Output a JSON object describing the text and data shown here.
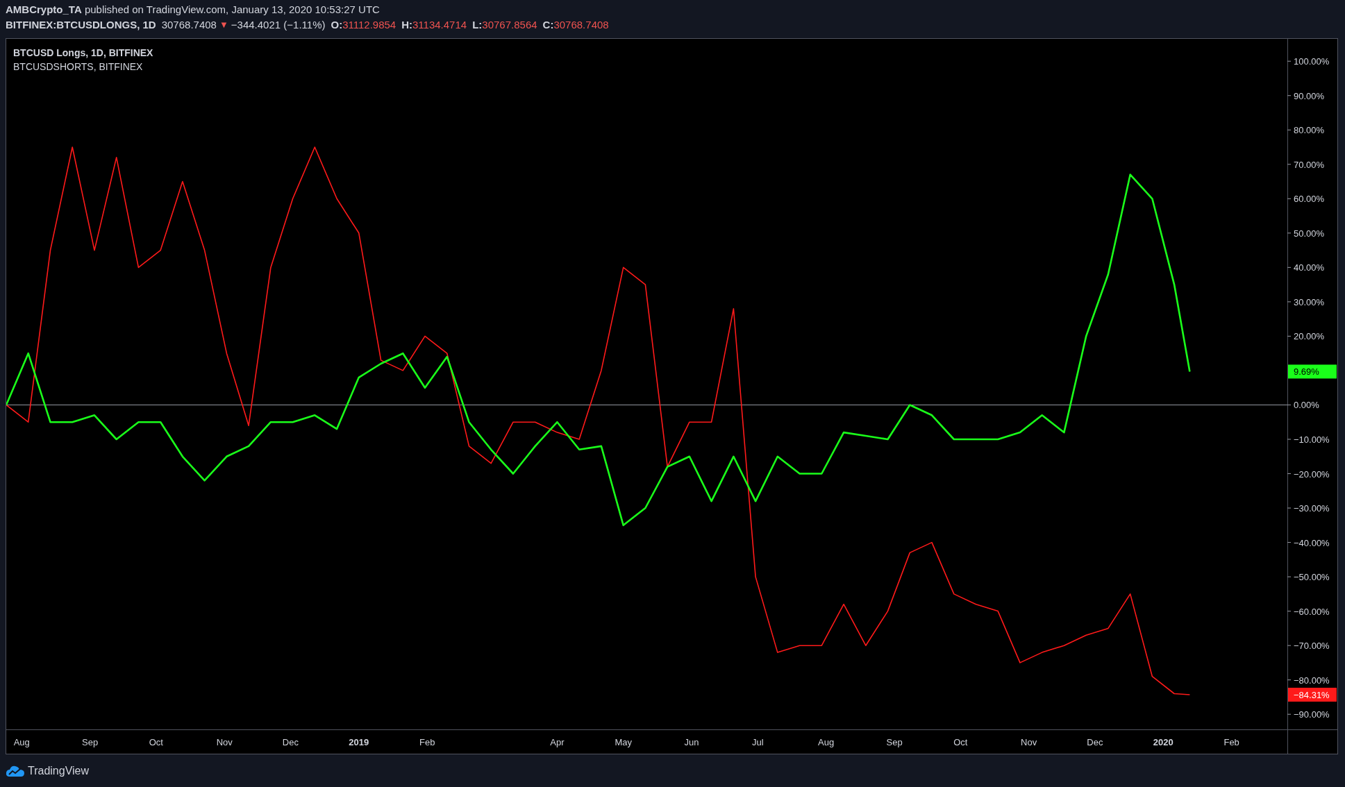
{
  "header": {
    "publish_info": "**AMBCrypto_TA** published on TradingView.com, January 13, 2020 10:53:27 UTC",
    "symbol": "BITFINEX:BTCUSDLONGS, 1D",
    "last": "30768.7408",
    "direction_icon": "▼",
    "change": "−344.4021 (−1.11%)",
    "ohlc": [
      {
        "label": "O:",
        "value": "31112.9854"
      },
      {
        "label": "H:",
        "value": "31134.4714"
      },
      {
        "label": "L:",
        "value": "30767.8564"
      },
      {
        "label": "C:",
        "value": "30768.7408"
      }
    ]
  },
  "chart": {
    "chart_data": {
      "type": "line",
      "x": [
        "2018-07-25",
        "2018-08-04",
        "2018-08-14",
        "2018-08-24",
        "2018-09-03",
        "2018-09-13",
        "2018-09-23",
        "2018-10-03",
        "2018-10-13",
        "2018-10-23",
        "2018-11-02",
        "2018-11-12",
        "2018-11-22",
        "2018-12-02",
        "2018-12-12",
        "2018-12-22",
        "2019-01-01",
        "2019-01-11",
        "2019-01-21",
        "2019-01-31",
        "2019-02-10",
        "2019-02-20",
        "2019-03-02",
        "2019-03-12",
        "2019-03-22",
        "2019-04-01",
        "2019-04-11",
        "2019-04-21",
        "2019-05-01",
        "2019-05-11",
        "2019-05-21",
        "2019-05-31",
        "2019-06-10",
        "2019-06-20",
        "2019-06-30",
        "2019-07-10",
        "2019-07-20",
        "2019-07-30",
        "2019-08-09",
        "2019-08-19",
        "2019-08-29",
        "2019-09-08",
        "2019-09-18",
        "2019-09-28",
        "2019-10-08",
        "2019-10-18",
        "2019-10-28",
        "2019-11-07",
        "2019-11-17",
        "2019-11-27",
        "2019-12-07",
        "2019-12-17",
        "2019-12-27",
        "2020-01-06",
        "2020-01-13"
      ],
      "series": [
        {
          "name": "BTCUSD Longs, 1D, BITFINEX",
          "color": "#ff1a1a",
          "values": [
            0,
            -5,
            45,
            75,
            45,
            72,
            40,
            45,
            65,
            45,
            15,
            -6,
            40,
            60,
            75,
            60,
            50,
            13,
            10,
            20,
            15,
            -12,
            -17,
            -5,
            -5,
            -8,
            -10,
            10,
            40,
            35,
            -18,
            -5,
            -5,
            28,
            -50,
            -72,
            -70,
            -70,
            -58,
            -70,
            -60,
            -43,
            -40,
            -55,
            -58,
            -60,
            -75,
            -72,
            -70,
            -67,
            -65,
            -55,
            -79,
            -84,
            -84.3
          ]
        },
        {
          "name": "BTCUSDSHORTS, BITFINEX",
          "color": "#1aff1a",
          "values": [
            0,
            15,
            -5,
            -5,
            -3,
            -10,
            -5,
            -5,
            -15,
            -22,
            -15,
            -12,
            -5,
            -5,
            -3,
            -7,
            8,
            12,
            15,
            5,
            14,
            -5,
            -13,
            -20,
            -12,
            -5,
            -13,
            -12,
            -35,
            -30,
            -18,
            -15,
            -28,
            -15,
            -28,
            -15,
            -20,
            -20,
            -8,
            -9,
            -10,
            0,
            -3,
            -10,
            -10,
            -10,
            -8,
            -3,
            -8,
            20,
            38,
            67,
            60,
            35,
            9.7
          ]
        }
      ],
      "xlim": [
        "2018-07-25",
        "2020-03-20"
      ],
      "ylim": [
        -94.4,
        106.5
      ],
      "xticks": [
        {
          "value": "2018-08-01",
          "label": "Aug"
        },
        {
          "value": "2018-09-01",
          "label": "Sep"
        },
        {
          "value": "2018-10-01",
          "label": "Oct"
        },
        {
          "value": "2018-11-01",
          "label": "Nov"
        },
        {
          "value": "2018-12-01",
          "label": "Dec"
        },
        {
          "value": "2019-01-01",
          "label": "2019"
        },
        {
          "value": "2019-02-01",
          "label": "Feb"
        },
        {
          "value": "2019-04-01",
          "label": "Apr"
        },
        {
          "value": "2019-05-01",
          "label": "May"
        },
        {
          "value": "2019-06-01",
          "label": "Jun"
        },
        {
          "value": "2019-07-01",
          "label": "Jul"
        },
        {
          "value": "2019-08-01",
          "label": "Aug"
        },
        {
          "value": "2019-09-01",
          "label": "Sep"
        },
        {
          "value": "2019-10-01",
          "label": "Oct"
        },
        {
          "value": "2019-11-01",
          "label": "Nov"
        },
        {
          "value": "2019-12-01",
          "label": "Dec"
        },
        {
          "value": "2020-01-01",
          "label": "2020"
        },
        {
          "value": "2020-02-01",
          "label": "Feb"
        }
      ],
      "yticks": [
        {
          "value": 100,
          "label": "100.00%"
        },
        {
          "value": 90,
          "label": "90.00%"
        },
        {
          "value": 80,
          "label": "80.00%"
        },
        {
          "value": 70,
          "label": "70.00%"
        },
        {
          "value": 60,
          "label": "60.00%"
        },
        {
          "value": 50,
          "label": "50.00%"
        },
        {
          "value": 40,
          "label": "40.00%"
        },
        {
          "value": 30,
          "label": "30.00%"
        },
        {
          "value": 20,
          "label": "20.00%"
        },
        {
          "value": 0,
          "label": "0.00%"
        },
        {
          "value": -10,
          "label": "−10.00%"
        },
        {
          "value": -20,
          "label": "−20.00%"
        },
        {
          "value": -30,
          "label": "−30.00%"
        },
        {
          "value": -40,
          "label": "−40.00%"
        },
        {
          "value": -50,
          "label": "−50.00%"
        },
        {
          "value": -60,
          "label": "−60.00%"
        },
        {
          "value": -70,
          "label": "−70.00%"
        },
        {
          "value": -80,
          "label": "−80.00%"
        },
        {
          "value": -90,
          "label": "−90.00%"
        }
      ],
      "annotations": [
        "−84.31%",
        "9.69%"
      ]
    }
  },
  "footer": {
    "brand": "TradingView"
  }
}
